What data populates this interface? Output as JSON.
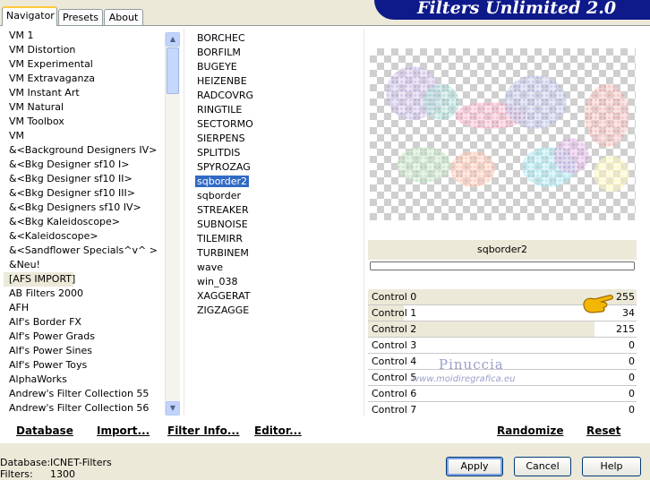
{
  "header": {
    "title": "Filters Unlimited 2.0"
  },
  "tabs": [
    "Navigator",
    "Presets",
    "About"
  ],
  "categories": [
    "VM 1",
    "VM Distortion",
    "VM Experimental",
    "VM Extravaganza",
    "VM Instant Art",
    "VM Natural",
    "VM Toolbox",
    "VM",
    "&<Background Designers IV>",
    "&<Bkg Designer sf10 I>",
    "&<Bkg Designer sf10 II>",
    "&<Bkg Designer sf10 III>",
    "&<Bkg Designers sf10 IV>",
    "&<Bkg Kaleidoscope>",
    "&<Kaleidoscope>",
    "&<Sandflower Specials^v^ >",
    "&Neu!",
    "[AFS IMPORT]",
    "AB Filters 2000",
    "AFH",
    "Alf's Border FX",
    "Alf's Power Grads",
    "Alf's Power Sines",
    "Alf's Power Toys",
    "AlphaWorks",
    "Andrew's Filter Collection 55",
    "Andrew's Filter Collection 56"
  ],
  "selected_category_index": 17,
  "filters": [
    "BORCHEC",
    "BORFILM",
    "BUGEYE",
    "HEIZENBE",
    "RADCOVRG",
    "RINGTILE",
    "SECTORMO",
    "SIERPENS",
    "SPLITDIS",
    "SPYROZAG",
    "sqborder2",
    "sqborder",
    "STREAKER",
    "SUBNOISE",
    "TILEMIRR",
    "TURBINEM",
    "wave",
    "win_038",
    "XAGGERAT",
    "ZIGZAGGE"
  ],
  "selected_filter_index": 10,
  "preview": {
    "filter_name": "sqborder2",
    "progress": 0
  },
  "controls": [
    {
      "label": "Control 0",
      "value": "255",
      "level": 1.0
    },
    {
      "label": "Control 1",
      "value": "34",
      "level": 0.133
    },
    {
      "label": "Control 2",
      "value": "215",
      "level": 0.843
    },
    {
      "label": "Control 3",
      "value": "0",
      "level": 0
    },
    {
      "label": "Control 4",
      "value": "0",
      "level": 0
    },
    {
      "label": "Control 5",
      "value": "0",
      "level": 0
    },
    {
      "label": "Control 6",
      "value": "0",
      "level": 0
    },
    {
      "label": "Control 7",
      "value": "0",
      "level": 0
    }
  ],
  "watermark": {
    "name": "Pinuccia",
    "url": "www.moidiregrafica.eu"
  },
  "bottom_links": {
    "database": "Database",
    "import": "Import...",
    "filter_info": "Filter Info...",
    "editor": "Editor...",
    "randomize": "Randomize",
    "reset": "Reset"
  },
  "status": {
    "database_label": "Database:",
    "database_value": "ICNET-Filters",
    "filters_label": "Filters:",
    "filters_value": "1300"
  },
  "buttons": {
    "apply": "Apply",
    "cancel": "Cancel",
    "help": "Help"
  }
}
